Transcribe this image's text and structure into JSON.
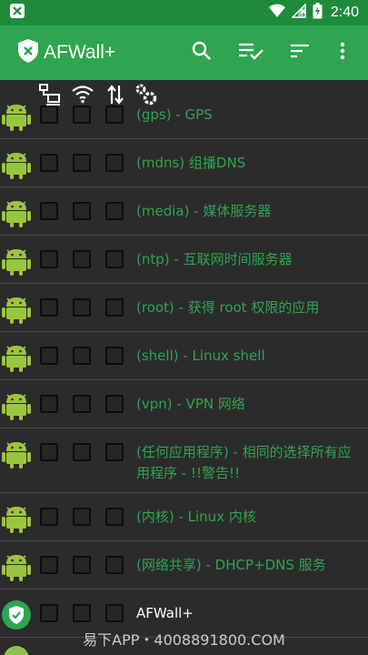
{
  "status_bar": {
    "time": "2:40",
    "icons": [
      "notification-x-icon",
      "wifi-icon",
      "signal-icon",
      "battery-charging-icon"
    ]
  },
  "app_bar": {
    "title": "AFWall+",
    "actions": [
      "search-icon",
      "playlist-check-icon",
      "sort-icon",
      "more-vert-icon"
    ],
    "color": "#2ea54e"
  },
  "column_headers": [
    "lan-icon",
    "wifi-icon",
    "mobile-data-icon",
    "vpn-settings-icon"
  ],
  "apps": [
    {
      "label": "(gps) - GPS",
      "icon": "android-icon",
      "color": "green"
    },
    {
      "label": "(mdns) 组播DNS",
      "icon": "android-icon",
      "color": "green"
    },
    {
      "label": "(media) - 媒体服务器",
      "icon": "android-icon",
      "color": "green"
    },
    {
      "label": "(ntp) - 互联网时间服务器",
      "icon": "android-icon",
      "color": "green"
    },
    {
      "label": "(root) - 获得 root 权限的应用",
      "icon": "android-icon",
      "color": "green"
    },
    {
      "label": "(shell) - Linux shell",
      "icon": "android-icon",
      "color": "green"
    },
    {
      "label": "(vpn) - VPN 网络",
      "icon": "android-icon",
      "color": "green"
    },
    {
      "label": "(任何应用程序) - 相同的选择所有应用程序 - !!警告!!",
      "icon": "android-icon",
      "color": "green"
    },
    {
      "label": "(内核) - Linux 内核",
      "icon": "android-icon",
      "color": "green"
    },
    {
      "label": "(网络共享) - DHCP+DNS 服务",
      "icon": "android-icon",
      "color": "green"
    },
    {
      "label": "AFWall+",
      "icon": "afwall-shield-icon",
      "color": "white"
    }
  ],
  "watermark": "易下APP・4008891800.COM"
}
